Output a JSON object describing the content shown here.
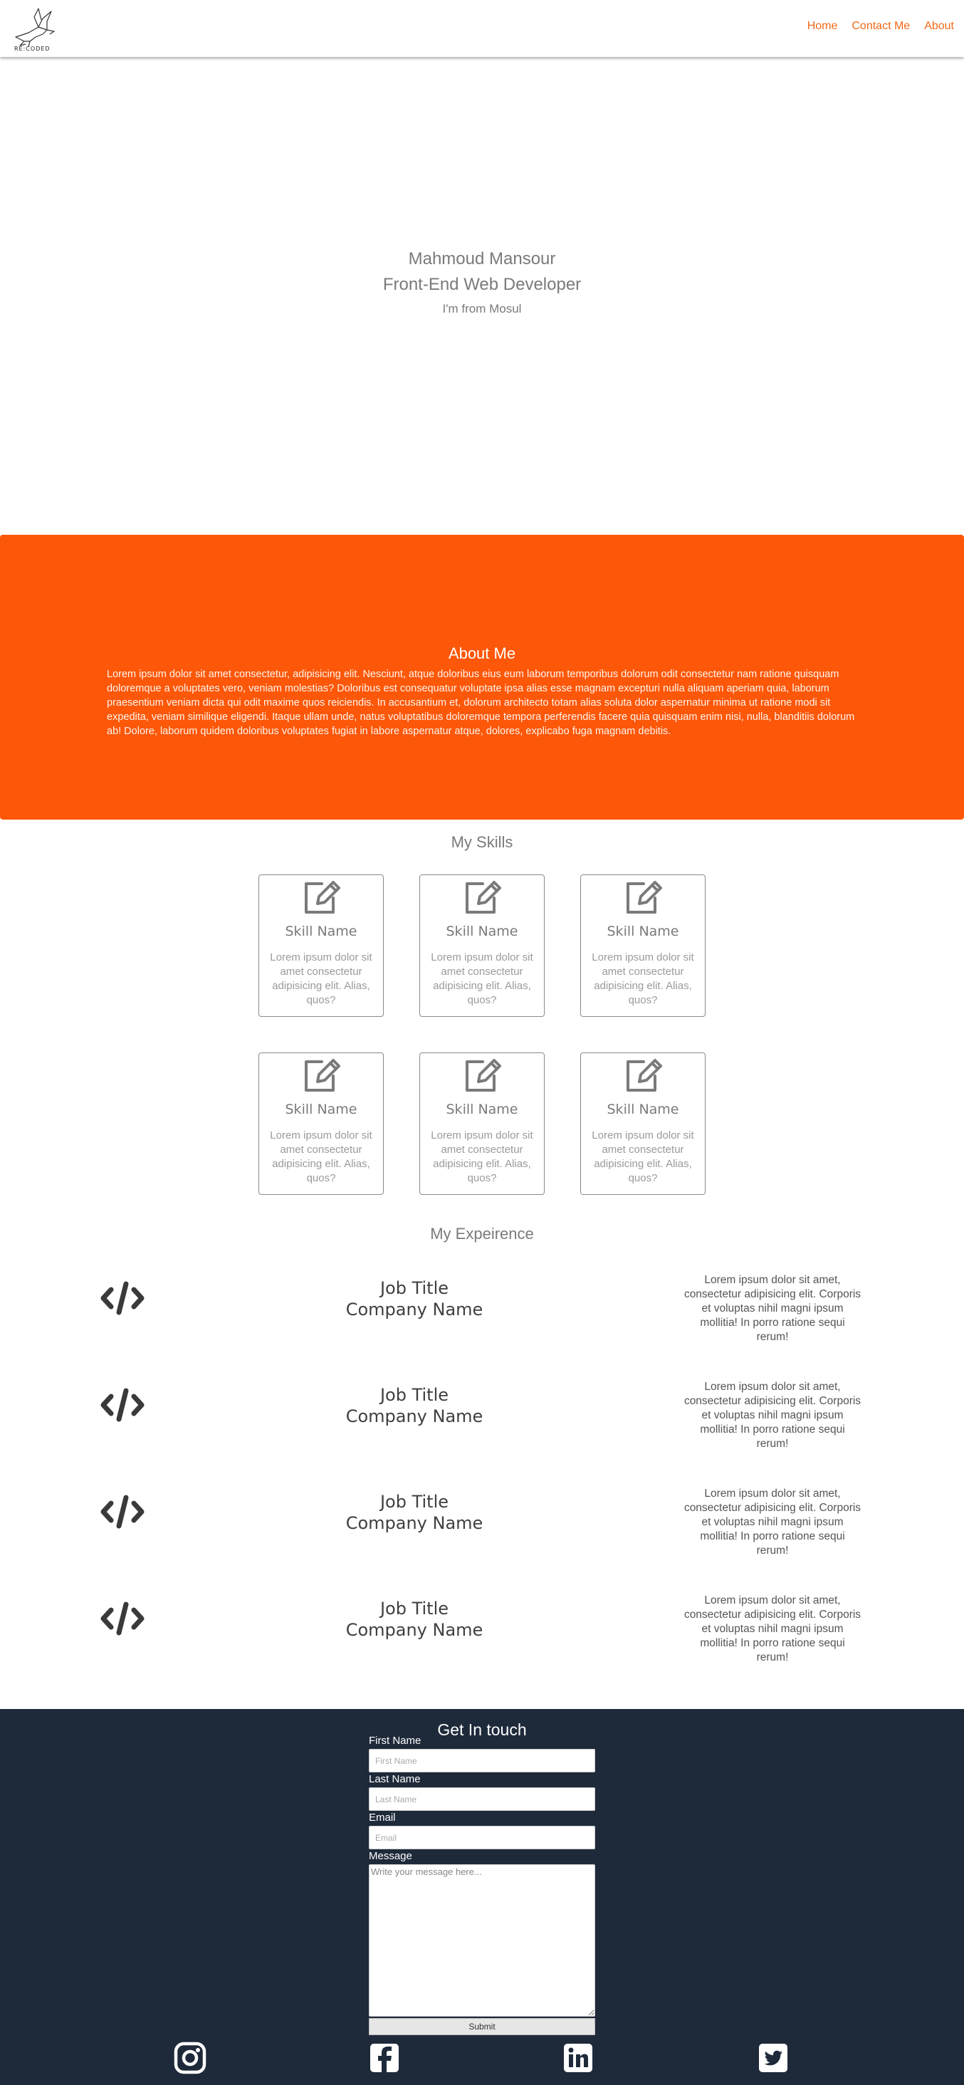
{
  "nav": {
    "logo_text": "RE:CODED",
    "links": [
      "Home",
      "Contact Me",
      "About"
    ]
  },
  "hero": {
    "name": "Mahmoud Mansour",
    "role": "Front-End Web Developer",
    "from": "I'm from Mosul"
  },
  "about": {
    "title": "About Me",
    "text": "Lorem ipsum dolor sit amet consectetur, adipisicing elit. Nesciunt, atque doloribus eius eum laborum temporibus dolorum odit consectetur nam ratione quisquam doloremque a voluptates vero, veniam molestias? Doloribus est consequatur voluptate ipsa alias esse magnam excepturi nulla aliquam aperiam quia, laborum praesentium veniam dicta qui odit maxime quos reiciendis. In accusantium et, dolorum architecto totam alias soluta dolor aspernatur minima ut ratione modi sit expedita, veniam similique eligendi. Itaque ullam unde, natus voluptatibus doloremque tempora perferendis facere quia quisquam enim nisi, nulla, blanditiis dolorum ab! Dolore, laborum quidem doloribus voluptates fugiat in labore aspernatur atque, dolores, explicabo fuga magnam debitis."
  },
  "skills": {
    "title": "My Skills",
    "items": [
      {
        "name": "Skill Name",
        "desc": "Lorem ipsum dolor sit amet consectetur adipisicing elit. Alias, quos?"
      },
      {
        "name": "Skill Name",
        "desc": "Lorem ipsum dolor sit amet consectetur adipisicing elit. Alias, quos?"
      },
      {
        "name": "Skill Name",
        "desc": "Lorem ipsum dolor sit amet consectetur adipisicing elit. Alias, quos?"
      },
      {
        "name": "Skill Name",
        "desc": "Lorem ipsum dolor sit amet consectetur adipisicing elit. Alias, quos?"
      },
      {
        "name": "Skill Name",
        "desc": "Lorem ipsum dolor sit amet consectetur adipisicing elit. Alias, quos?"
      },
      {
        "name": "Skill Name",
        "desc": "Lorem ipsum dolor sit amet consectetur adipisicing elit. Alias, quos?"
      }
    ]
  },
  "experience": {
    "title": "My Expeirence",
    "items": [
      {
        "job": "Job Title",
        "company": "Company Name",
        "desc": "Lorem ipsum dolor sit amet, consectetur adipisicing elit. Corporis et voluptas nihil magni ipsum mollitia! In porro ratione sequi rerum!"
      },
      {
        "job": "Job Title",
        "company": "Company Name",
        "desc": "Lorem ipsum dolor sit amet, consectetur adipisicing elit. Corporis et voluptas nihil magni ipsum mollitia! In porro ratione sequi rerum!"
      },
      {
        "job": "Job Title",
        "company": "Company Name",
        "desc": "Lorem ipsum dolor sit amet, consectetur adipisicing elit. Corporis et voluptas nihil magni ipsum mollitia! In porro ratione sequi rerum!"
      },
      {
        "job": "Job Title",
        "company": "Company Name",
        "desc": "Lorem ipsum dolor sit amet, consectetur adipisicing elit. Corporis et voluptas nihil magni ipsum mollitia! In porro ratione sequi rerum!"
      }
    ]
  },
  "contact": {
    "title": "Get In touch",
    "first_name_label": "First Name",
    "first_name_placeholder": "First Name",
    "last_name_label": "Last Name",
    "last_name_placeholder": "Last Name",
    "email_label": "Email",
    "email_placeholder": "Email",
    "message_label": "Message",
    "message_placeholder": "Write your message here...",
    "submit_label": "Submit"
  },
  "icons": {
    "logo": "hummingbird-logo",
    "skill": "edit-icon",
    "experience": "code-icon",
    "social": [
      "instagram-icon",
      "facebook-icon",
      "linkedin-icon",
      "twitter-icon"
    ]
  },
  "colors": {
    "accent": "#fd5709",
    "nav_link": "#f26a1b",
    "footer_bg": "#1e2a3a"
  }
}
